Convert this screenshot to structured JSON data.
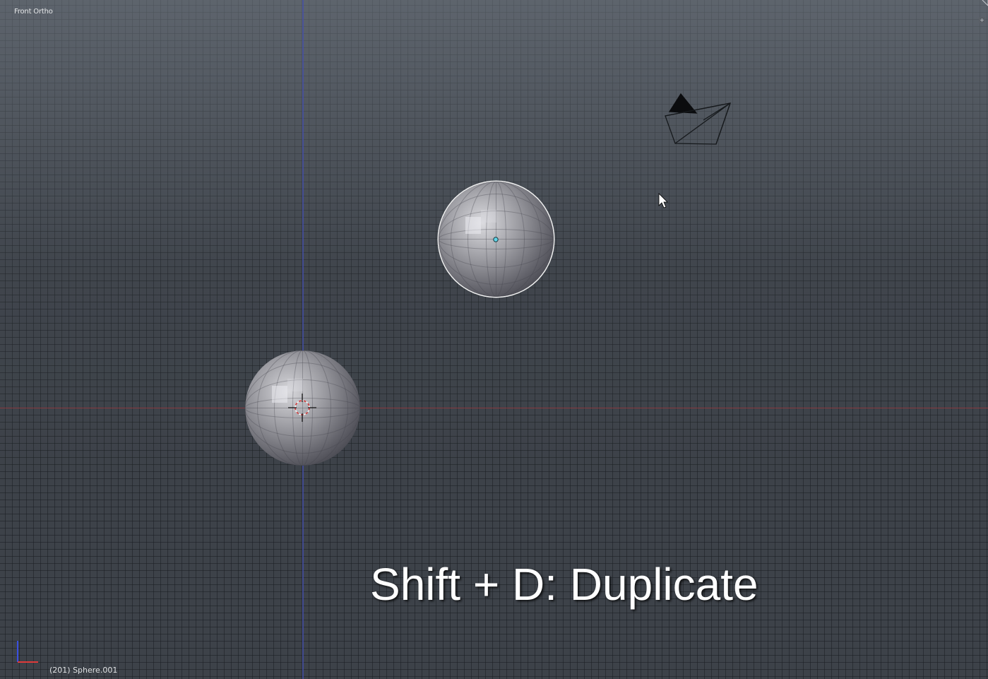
{
  "viewport": {
    "view_name": "Front Ortho",
    "status": "(201) Sphere.001"
  },
  "caption": {
    "text": "Shift + D: Duplicate"
  },
  "icons": {
    "mouse_cursor": "arrow-cursor-icon",
    "camera": "camera-icon",
    "cursor_3d": "3d-cursor-icon",
    "axis_gizmo": "axis-gizmo-icon",
    "corner_widget": "plus-icon"
  },
  "colors": {
    "selection_outline": "#f2f2f2",
    "x_axis": "#a03c41",
    "z_axis": "#4650aa",
    "origin_dot": "#5fd3e6"
  }
}
